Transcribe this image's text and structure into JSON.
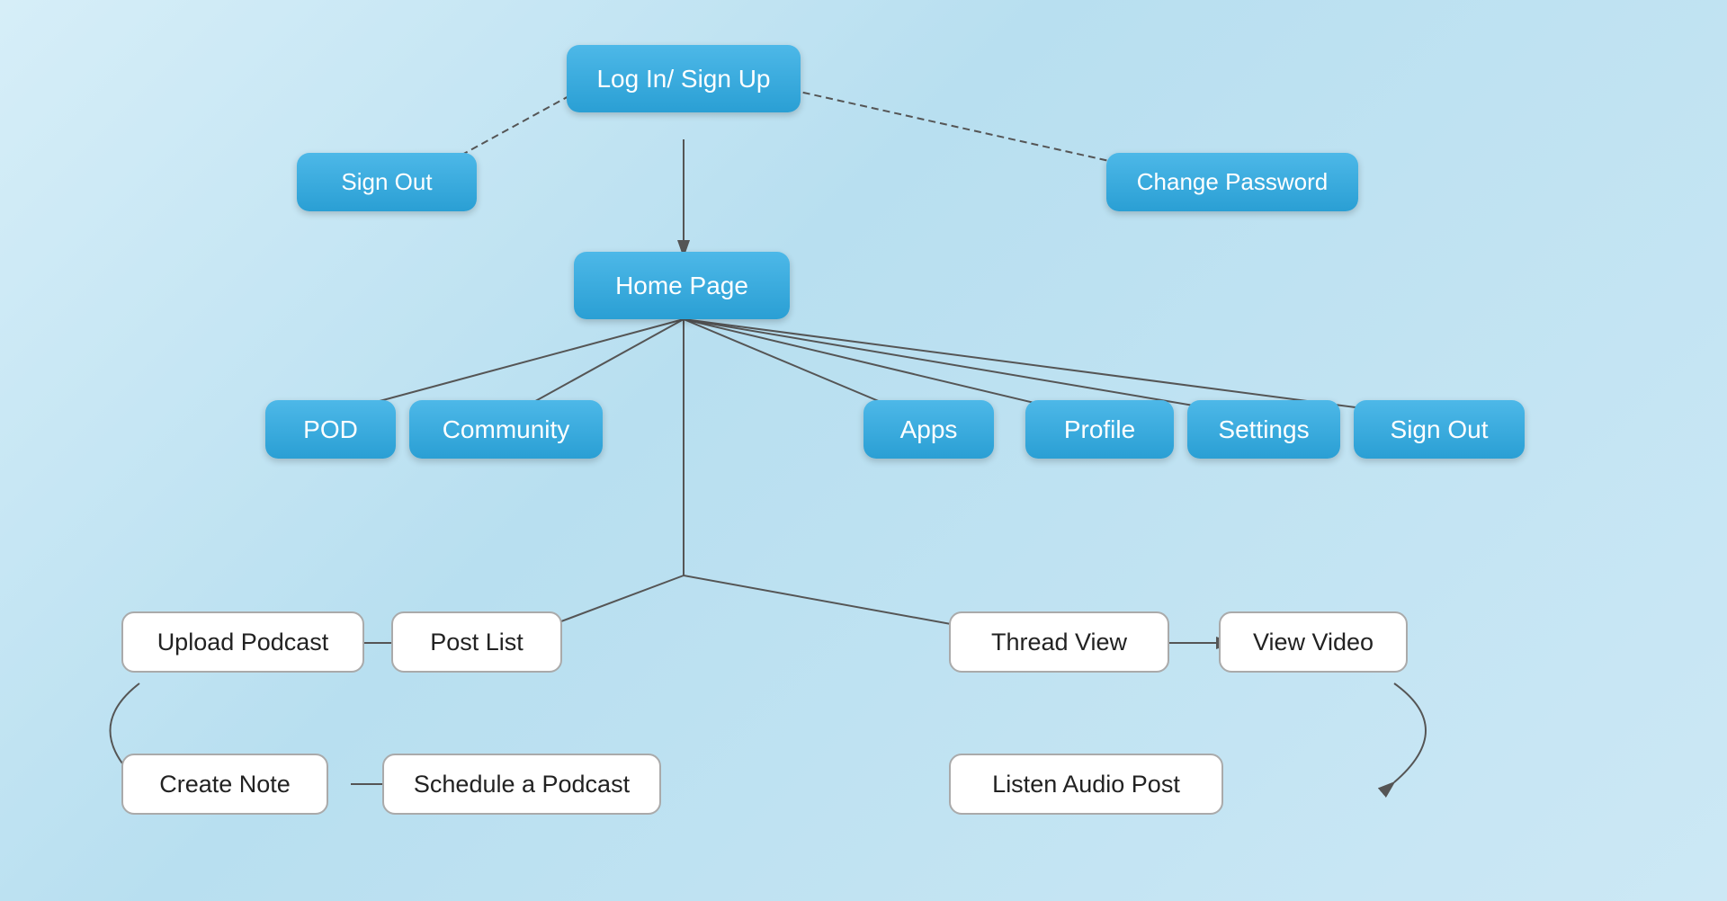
{
  "nodes": {
    "login": {
      "label": "Log In/ Sign Up"
    },
    "signout_top": {
      "label": "Sign Out"
    },
    "change_password": {
      "label": "Change Password"
    },
    "home_page": {
      "label": "Home Page"
    },
    "pod": {
      "label": "POD"
    },
    "community": {
      "label": "Community"
    },
    "apps": {
      "label": "Apps"
    },
    "profile": {
      "label": "Profile"
    },
    "settings": {
      "label": "Settings"
    },
    "signout_bottom": {
      "label": "Sign Out"
    },
    "upload_podcast": {
      "label": "Upload Podcast"
    },
    "post_list": {
      "label": "Post List"
    },
    "thread_view": {
      "label": "Thread View"
    },
    "view_video": {
      "label": "View Video"
    },
    "create_note": {
      "label": "Create Note"
    },
    "schedule_podcast": {
      "label": "Schedule a Podcast"
    },
    "listen_audio": {
      "label": "Listen Audio Post"
    }
  }
}
